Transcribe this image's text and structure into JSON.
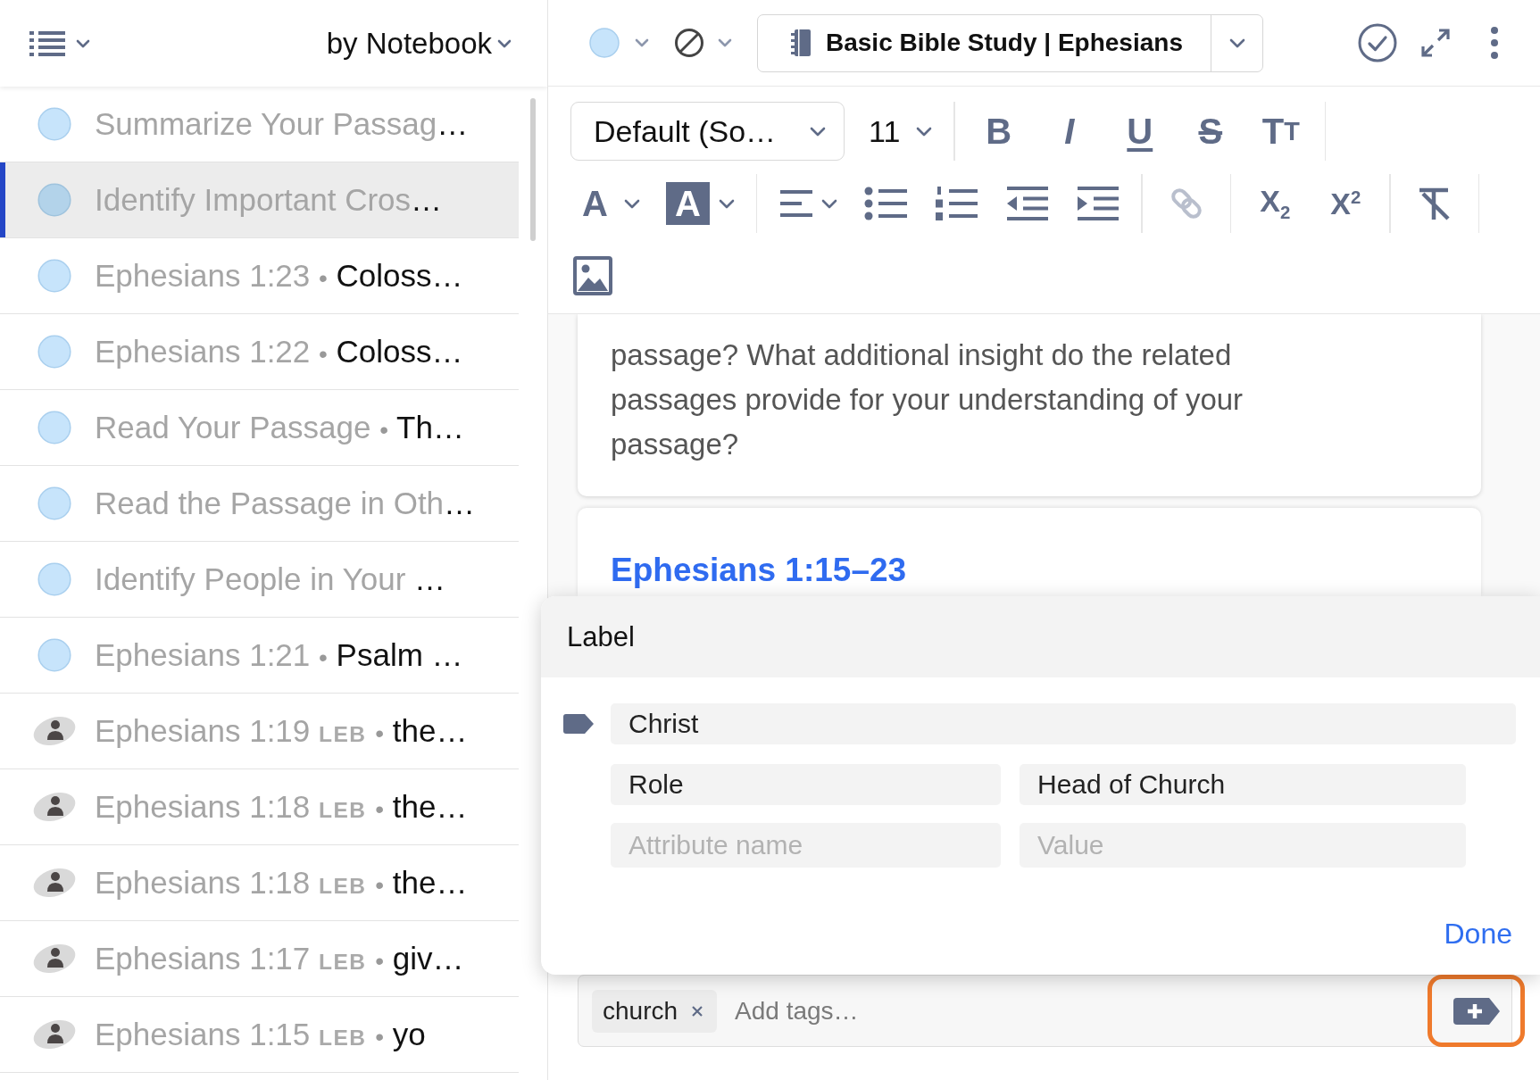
{
  "sidebar": {
    "group_by": "by Notebook",
    "items": [
      {
        "kind": "note",
        "title": "Summarize Your Passag",
        "snippet": "…",
        "selected": false
      },
      {
        "kind": "note",
        "title": "Identify Important Cros",
        "snippet": "…",
        "selected": true
      },
      {
        "kind": "note",
        "title": "Ephesians 1:23",
        "separator": "•",
        "snippet": "Coloss…",
        "selected": false
      },
      {
        "kind": "note",
        "title": "Ephesians 1:22",
        "separator": "•",
        "snippet": "Coloss…",
        "selected": false
      },
      {
        "kind": "note",
        "title": "Read Your Passage",
        "separator": "•",
        "snippet": "Th…",
        "selected": false
      },
      {
        "kind": "note",
        "title": "Read the Passage in Oth",
        "snippet": "…",
        "selected": false
      },
      {
        "kind": "note",
        "title": "Identify People in Your ",
        "snippet": "…",
        "selected": false
      },
      {
        "kind": "note",
        "title": "Ephesians 1:21",
        "separator": "•",
        "snippet": "Psalm …",
        "selected": false
      },
      {
        "kind": "person",
        "title": "Ephesians 1:19",
        "version": "LEB",
        "separator": "•",
        "snippet": "the…",
        "selected": false
      },
      {
        "kind": "person",
        "title": "Ephesians 1:18",
        "version": "LEB",
        "separator": "•",
        "snippet": "the…",
        "selected": false
      },
      {
        "kind": "person",
        "title": "Ephesians 1:18",
        "version": "LEB",
        "separator": "•",
        "snippet": "the…",
        "selected": false
      },
      {
        "kind": "person",
        "title": "Ephesians 1:17",
        "version": "LEB",
        "separator": "•",
        "snippet": "giv…",
        "selected": false
      },
      {
        "kind": "person",
        "title": "Ephesians 1:15",
        "version": "LEB",
        "separator": "•",
        "snippet": "yo",
        "selected": false
      }
    ]
  },
  "note_header": {
    "notebook": "Basic Bible Study | Ephesians"
  },
  "format_bar": {
    "font": "Default (So…",
    "size": "11",
    "top_row": [
      {
        "kind": "separator"
      },
      {
        "kind": "bold",
        "text": "B",
        "disabled": false
      },
      {
        "kind": "italic",
        "text": "I",
        "disabled": false
      },
      {
        "kind": "underline",
        "text": "U",
        "disabled": false
      },
      {
        "kind": "strike",
        "text": "S",
        "disabled": false
      },
      {
        "kind": "text-size",
        "text": "T",
        "small": "T",
        "disabled": false
      },
      {
        "kind": "separator"
      }
    ],
    "middle_row": [
      {
        "kind": "font-color",
        "text": "A",
        "disabled": false
      },
      {
        "kind": "highlight",
        "text": "A",
        "disabled": false
      },
      {
        "kind": "separator"
      },
      {
        "kind": "align",
        "disabled": false
      },
      {
        "kind": "bullets",
        "disabled": false
      },
      {
        "kind": "numbers",
        "disabled": false
      },
      {
        "kind": "outdent",
        "disabled": false
      },
      {
        "kind": "indent",
        "disabled": false
      },
      {
        "kind": "separator"
      },
      {
        "kind": "link",
        "disabled": true
      },
      {
        "kind": "separator"
      },
      {
        "kind": "subscript",
        "text": "X$_{2}$",
        "disabled": false
      },
      {
        "kind": "superscript",
        "text": "X$^{2}$",
        "disabled": false
      },
      {
        "kind": "separator"
      },
      {
        "kind": "clear",
        "disabled": false
      },
      {
        "kind": "separator"
      }
    ],
    "bottom_row": [
      {
        "kind": "image",
        "disabled": false
      }
    ]
  },
  "note_body": {
    "prompt": "passage? What additional insight do the related passages provide for your understanding of your passage?",
    "passage_heading": "Ephesians 1:15–23"
  },
  "label_editor": {
    "title": "Label",
    "label": {
      "value": "Christ"
    },
    "attributes": [
      {
        "name": "Role",
        "value": "Head of Church"
      }
    ],
    "new_attribute": {
      "name": {
        "placeholder": "Attribute name"
      },
      "value": {
        "placeholder": "Value"
      }
    },
    "done": "Done"
  },
  "tags": {
    "chips": [
      "church"
    ],
    "input": {
      "placeholder": "Add tags…"
    }
  }
}
